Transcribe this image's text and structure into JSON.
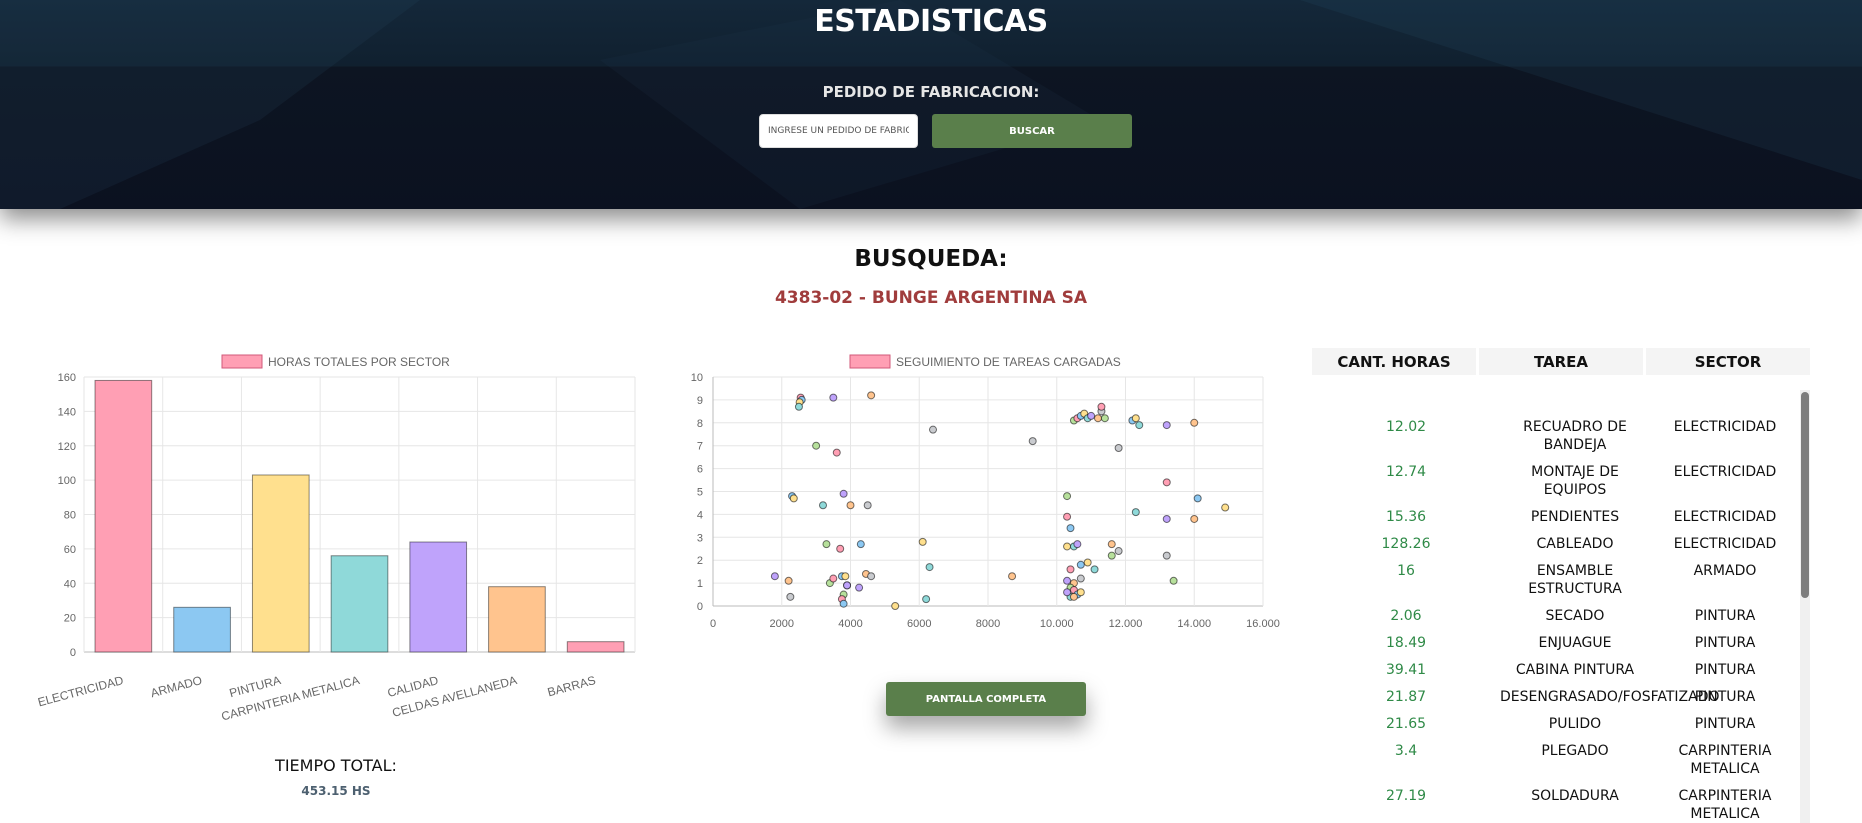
{
  "header": {
    "title": "ESTADISTICAS",
    "search_label": "PEDIDO DE FABRICACION:",
    "search_placeholder": "INGRESE UN PEDIDO DE FABRICACION",
    "search_button": "BUSCAR"
  },
  "results": {
    "heading": "BUSQUEDA:",
    "order": "4383-02 - BUNGE ARGENTINA SA"
  },
  "total": {
    "label": "TIEMPO TOTAL:",
    "value": "453.15 HS"
  },
  "fullscreen_button": "PANTALLA COMPLETA",
  "table": {
    "headers": [
      "CANT. HORAS",
      "TAREA",
      "SECTOR"
    ],
    "rows": [
      [
        "12.02",
        "RECUADRO DE BANDEJA",
        "ELECTRICIDAD"
      ],
      [
        "12.74",
        "MONTAJE DE EQUIPOS",
        "ELECTRICIDAD"
      ],
      [
        "15.36",
        "PENDIENTES",
        "ELECTRICIDAD"
      ],
      [
        "128.26",
        "CABLEADO",
        "ELECTRICIDAD"
      ],
      [
        "16",
        "ENSAMBLE ESTRUCTURA",
        "ARMADO"
      ],
      [
        "2.06",
        "SECADO",
        "PINTURA"
      ],
      [
        "18.49",
        "ENJUAGUE",
        "PINTURA"
      ],
      [
        "39.41",
        "CABINA PINTURA",
        "PINTURA"
      ],
      [
        "21.87",
        "DESENGRASADO/FOSFATIZADO",
        "PINTURA"
      ],
      [
        "21.65",
        "PULIDO",
        "PINTURA"
      ],
      [
        "3.4",
        "PLEGADO",
        "CARPINTERIA METALICA"
      ],
      [
        "27.19",
        "SOLDADURA",
        "CARPINTERIA METALICA"
      ]
    ]
  },
  "chart_data": [
    {
      "type": "bar",
      "title": "",
      "legend": "HORAS TOTALES POR SECTOR",
      "categories": [
        "ELECTRICIDAD",
        "ARMADO",
        "PINTURA",
        "CARPINTERIA METALICA",
        "CALIDAD",
        "CELDAS AVELLANEDA",
        "BARRAS"
      ],
      "values": [
        158,
        26,
        103,
        56,
        64,
        38,
        6
      ],
      "colors": [
        "#ff9fb4",
        "#8cc8f2",
        "#ffe08e",
        "#8fd9d9",
        "#bfa3fb",
        "#ffc48e",
        "#ff9fb4"
      ],
      "ylim": [
        0,
        160
      ],
      "yticks": [
        "0",
        "20",
        "40",
        "60",
        "80",
        "100",
        "120",
        "140",
        "160"
      ],
      "grid": true,
      "legend_position": "top"
    },
    {
      "type": "scatter",
      "title": "",
      "legend": "SEGUIMIENTO DE TAREAS CARGADAS",
      "xlim": [
        0,
        16000
      ],
      "ylim": [
        0,
        10
      ],
      "xticks": [
        "0",
        "2000",
        "4000",
        "6000",
        "8000",
        "10.000",
        "12.000",
        "14.000",
        "16.000"
      ],
      "yticks": [
        "0",
        "1",
        "2",
        "3",
        "4",
        "5",
        "6",
        "7",
        "8",
        "9",
        "10"
      ],
      "grid": true,
      "legend_position": "top",
      "palette": [
        "#ff9fb4",
        "#8cc8f2",
        "#ffe08e",
        "#8fd9d9",
        "#bfa3fb",
        "#ffc48e",
        "#c9cbcf",
        "#b7e09c"
      ],
      "points": [
        [
          2550,
          9.1
        ],
        [
          2580,
          9.0
        ],
        [
          2520,
          8.9
        ],
        [
          2500,
          8.7
        ],
        [
          3500,
          9.1
        ],
        [
          4600,
          9.2
        ],
        [
          6400,
          7.7
        ],
        [
          3000,
          7.0
        ],
        [
          3600,
          6.7
        ],
        [
          2300,
          4.8
        ],
        [
          2350,
          4.7
        ],
        [
          3200,
          4.4
        ],
        [
          3800,
          4.9
        ],
        [
          4000,
          4.4
        ],
        [
          4500,
          4.4
        ],
        [
          3300,
          2.7
        ],
        [
          3700,
          2.5
        ],
        [
          4300,
          2.7
        ],
        [
          6100,
          2.8
        ],
        [
          6300,
          1.7
        ],
        [
          1800,
          1.3
        ],
        [
          2200,
          1.1
        ],
        [
          2250,
          0.4
        ],
        [
          3400,
          1.0
        ],
        [
          3500,
          1.2
        ],
        [
          3750,
          1.3
        ],
        [
          3850,
          1.3
        ],
        [
          3900,
          0.9
        ],
        [
          4250,
          0.8
        ],
        [
          4450,
          1.4
        ],
        [
          4600,
          1.3
        ],
        [
          3800,
          0.5
        ],
        [
          3750,
          0.3
        ],
        [
          3800,
          0.1
        ],
        [
          5300,
          0.0
        ],
        [
          6200,
          0.3
        ],
        [
          3900,
          0.9
        ],
        [
          8700,
          1.3
        ],
        [
          9300,
          7.2
        ],
        [
          10500,
          8.1
        ],
        [
          10600,
          8.2
        ],
        [
          10700,
          8.3
        ],
        [
          10800,
          8.4
        ],
        [
          10900,
          8.2
        ],
        [
          11000,
          8.3
        ],
        [
          11200,
          8.2
        ],
        [
          11300,
          8.5
        ],
        [
          11400,
          8.2
        ],
        [
          11300,
          8.7
        ],
        [
          12200,
          8.1
        ],
        [
          12300,
          8.2
        ],
        [
          12400,
          7.9
        ],
        [
          13200,
          7.9
        ],
        [
          14000,
          8.0
        ],
        [
          11800,
          6.9
        ],
        [
          10300,
          4.8
        ],
        [
          10300,
          3.9
        ],
        [
          10400,
          3.4
        ],
        [
          10300,
          2.6
        ],
        [
          10500,
          2.6
        ],
        [
          10600,
          2.7
        ],
        [
          11600,
          2.7
        ],
        [
          11800,
          2.4
        ],
        [
          11600,
          2.2
        ],
        [
          13200,
          5.4
        ],
        [
          14100,
          4.7
        ],
        [
          14900,
          4.3
        ],
        [
          12300,
          4.1
        ],
        [
          13200,
          3.8
        ],
        [
          14000,
          3.8
        ],
        [
          13200,
          2.2
        ],
        [
          13400,
          1.1
        ],
        [
          10400,
          1.6
        ],
        [
          10700,
          1.8
        ],
        [
          10900,
          1.9
        ],
        [
          11100,
          1.6
        ],
        [
          10300,
          1.1
        ],
        [
          10500,
          1.0
        ],
        [
          10700,
          1.2
        ],
        [
          10400,
          0.8
        ],
        [
          10500,
          0.7
        ],
        [
          10600,
          0.5
        ],
        [
          10700,
          0.6
        ],
        [
          10400,
          0.4
        ],
        [
          10300,
          0.6
        ],
        [
          10500,
          0.4
        ]
      ]
    }
  ]
}
